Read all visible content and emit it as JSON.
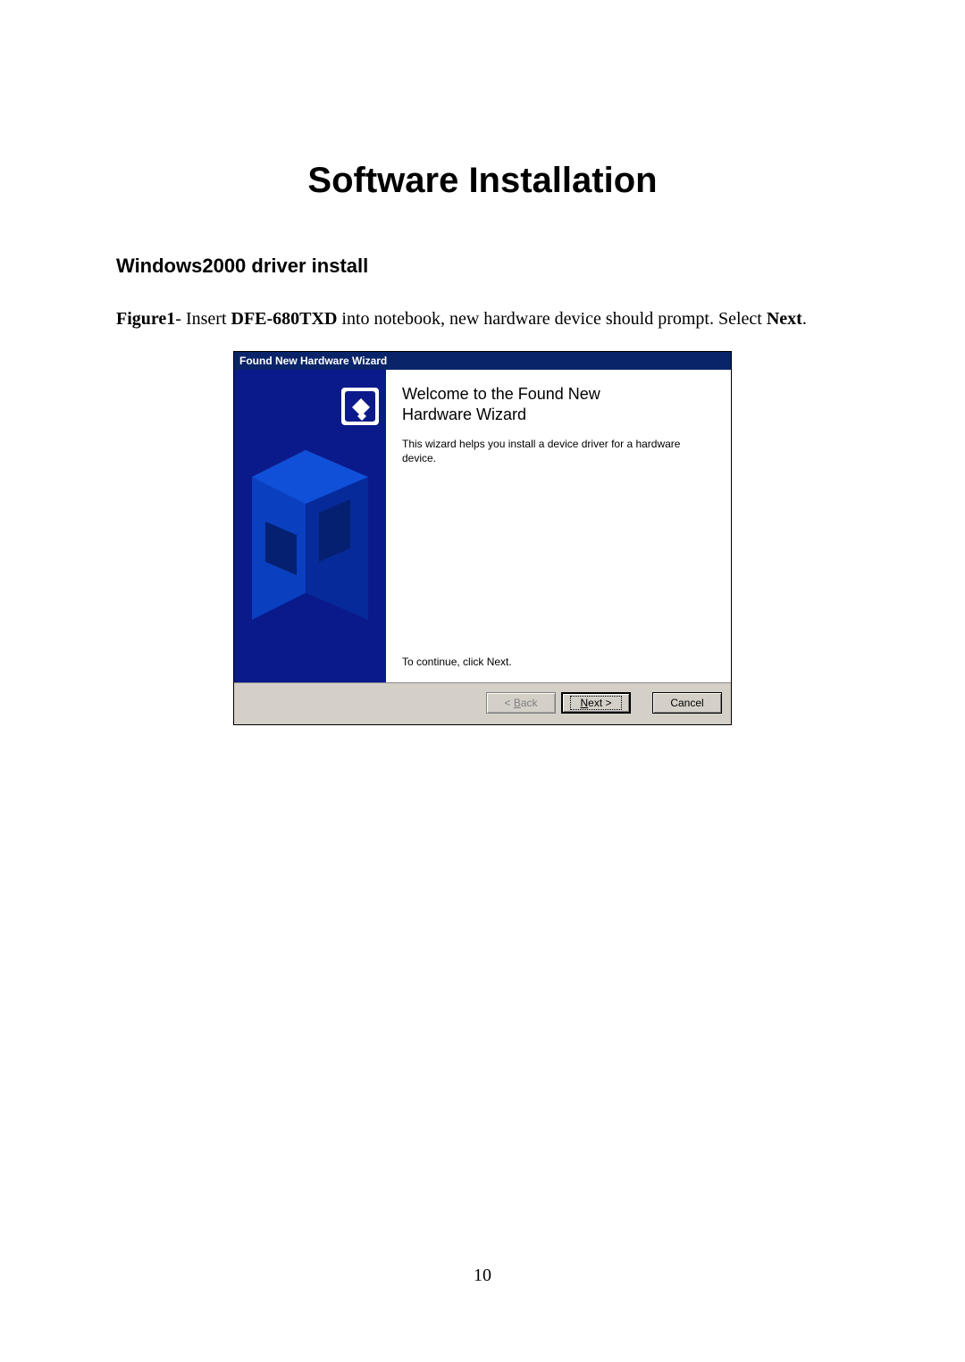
{
  "page": {
    "title": "Software Installation",
    "subheading": "Windows2000 driver install",
    "figure_label": "Figure1",
    "figure_sep": "- ",
    "figure_text_pre": " Insert ",
    "figure_product": "DFE-680TXD",
    "figure_text_mid": " into notebook, new hardware device should prompt. Select ",
    "figure_action": "Next",
    "figure_text_end": ".",
    "page_number": "10"
  },
  "wizard": {
    "titlebar": "Found New Hardware Wizard",
    "heading_line1": "Welcome to the Found New",
    "heading_line2": "Hardware Wizard",
    "desc": "This wizard helps you install a device driver for a hardware device.",
    "continue": "To continue, click Next.",
    "buttons": {
      "back": "< Back",
      "next": "Next >",
      "cancel": "Cancel"
    }
  }
}
